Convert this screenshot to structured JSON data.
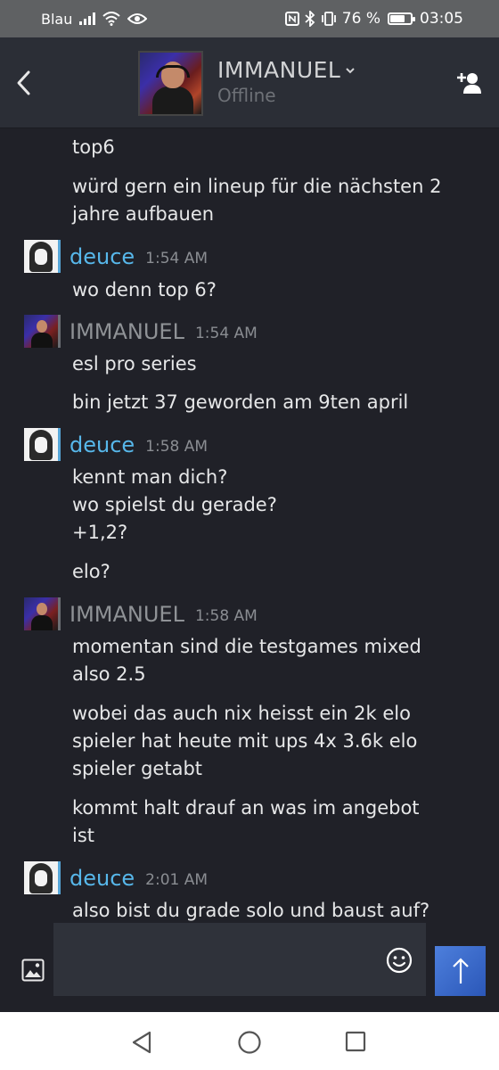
{
  "status_bar": {
    "carrier": "Blau",
    "battery_percent": "76 %",
    "battery_level": 0.76,
    "time": "03:05",
    "icons": [
      "signal-icon",
      "wifi-icon",
      "eye-icon",
      "nfc-icon",
      "bluetooth-icon",
      "vibrate-icon",
      "battery-icon"
    ]
  },
  "header": {
    "contact_name": "IMMANUEL",
    "contact_status": "Offline",
    "icons": [
      "back-icon",
      "chevron-down-icon",
      "add-friend-icon"
    ]
  },
  "messages": {
    "m0_text": "top6",
    "m1_text": "würd gern ein lineup für die nächsten 2\njahre aufbauen",
    "g2_sender": "deuce",
    "g2_time": "1:54 AM",
    "m2_text": "wo denn top 6?",
    "g3_sender": "IMMANUEL",
    "g3_time": "1:54 AM",
    "m3_text": "esl pro series",
    "m4_text": "bin jetzt 37 geworden am 9ten april",
    "g4_sender": "deuce",
    "g4_time": "1:58 AM",
    "m5_text": "kennt man dich?\nwo spielst du gerade?\n+1,2?",
    "m6_text": "elo?",
    "g5_sender": "IMMANUEL",
    "g5_time": "1:58 AM",
    "m7_text": "momentan sind die testgames mixed\nalso 2.5",
    "m8_text": "wobei das auch nix heisst ein 2k elo\nspieler hat heute mit ups 4x 3.6k elo\nspieler getabt",
    "m9_text": "kommt halt drauf an was im angebot\nist",
    "g6_sender": "deuce",
    "g6_time": "2:01 AM",
    "m10_text": "also bist du grade solo und baust auf?"
  },
  "input_bar": {
    "value": "",
    "icons": [
      "image-icon",
      "emoji-icon",
      "send-arrow-icon"
    ]
  },
  "nav_bar": {
    "icons": [
      "nav-back-icon",
      "nav-home-icon",
      "nav-recents-icon"
    ]
  },
  "colors": {
    "background": "#202128",
    "header": "#2b2e36",
    "deuce_name": "#57b7ea",
    "immanuel_name": "#8f9296",
    "send_button": "#3a6ccc"
  }
}
